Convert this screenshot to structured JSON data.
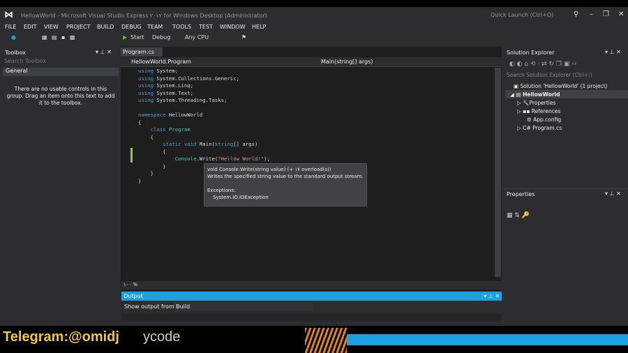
{
  "window": {
    "title": "HellowWorld - Microsoft Visual Studio Express ۲۰۱۲ for Windows Desktop (Administrator)",
    "quick_launch": "Quick Launch (Ctrl+Q)"
  },
  "menu": [
    "FILE",
    "EDIT",
    "VIEW",
    "PROJECT",
    "BUILD",
    "DEBUG",
    "TEAM",
    "TOOLS",
    "TEST",
    "WINDOW",
    "HELP"
  ],
  "toolbar": {
    "start": "Start",
    "config": "Debug",
    "platform": "Any CPU"
  },
  "toolbox": {
    "title": "Toolbox",
    "search_placeholder": "Search Toolbox",
    "group": "General",
    "message": "There are no usable controls in this group. Drag an item onto this text to add it to the toolbox."
  },
  "editor": {
    "tab": "Program.cs",
    "nav_left": "HellowWorld.Program",
    "nav_right": "Main(string[] args)",
    "zoom": "۱۰۰ %",
    "code": [
      "using System;",
      "using System.Collections.Generic;",
      "using System.Linq;",
      "using System.Text;",
      "using System.Threading.Tasks;",
      "",
      "namespace HellowWorld",
      "{",
      "    class Program",
      "    {",
      "        static void Main(string[] args)",
      "        {",
      "            Console.Write(\"Hellow World!\");",
      "        }",
      "    }",
      "}"
    ],
    "tooltip": {
      "signature": "void Console.Write(string value)  (+ ۱۷ overload(s))",
      "description": "Writes the specified string value to the standard output stream.",
      "exceptions_label": "Exceptions:",
      "exception": "System.IO.IOException"
    }
  },
  "output": {
    "title": "Output",
    "show_from_label": "Show output from:",
    "source": "Build"
  },
  "solution_explorer": {
    "title": "Solution Explorer",
    "search_placeholder": "Search Solution Explorer (Ctrl+;)",
    "items": [
      "Solution 'HellowWorld' (1 project)",
      "HellowWorld",
      "Properties",
      "References",
      "App.config",
      "Program.cs"
    ]
  },
  "properties": {
    "title": "Properties"
  },
  "watermark": {
    "text": "Telegram:@omidj",
    "text2": "ycode"
  },
  "colors": {
    "accent": "#1ba1e2",
    "background": "#2d2d30",
    "editor": "#1e1e1e"
  }
}
